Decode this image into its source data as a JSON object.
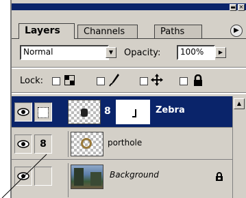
{
  "window": {
    "minimize_glyph": "▬",
    "close_glyph": "✕"
  },
  "tabs": [
    {
      "label": "Layers"
    },
    {
      "label": "Channels"
    },
    {
      "label": "Paths"
    }
  ],
  "palette_menu_glyph": "▶",
  "blend": {
    "mode": "Normal",
    "dropdown_glyph": "▼",
    "opacity_label": "Opacity:",
    "opacity_value": "100%",
    "opacity_arrow": "▶"
  },
  "lock": {
    "label": "Lock:"
  },
  "layers": [
    {
      "name": "Zebra",
      "selected": true,
      "eye": "👁",
      "mask_link": "8"
    },
    {
      "name": "porthole",
      "selected": false,
      "eye": "👁",
      "clip_link": "8"
    },
    {
      "name": "Background",
      "selected": false,
      "eye": "👁",
      "lock_glyph": "🔒"
    }
  ],
  "colors": {
    "selected_row": "#0a246a",
    "panel": "#d4d0c8",
    "title_bar": "#0a246a"
  },
  "scroll_up_glyph": "▲"
}
